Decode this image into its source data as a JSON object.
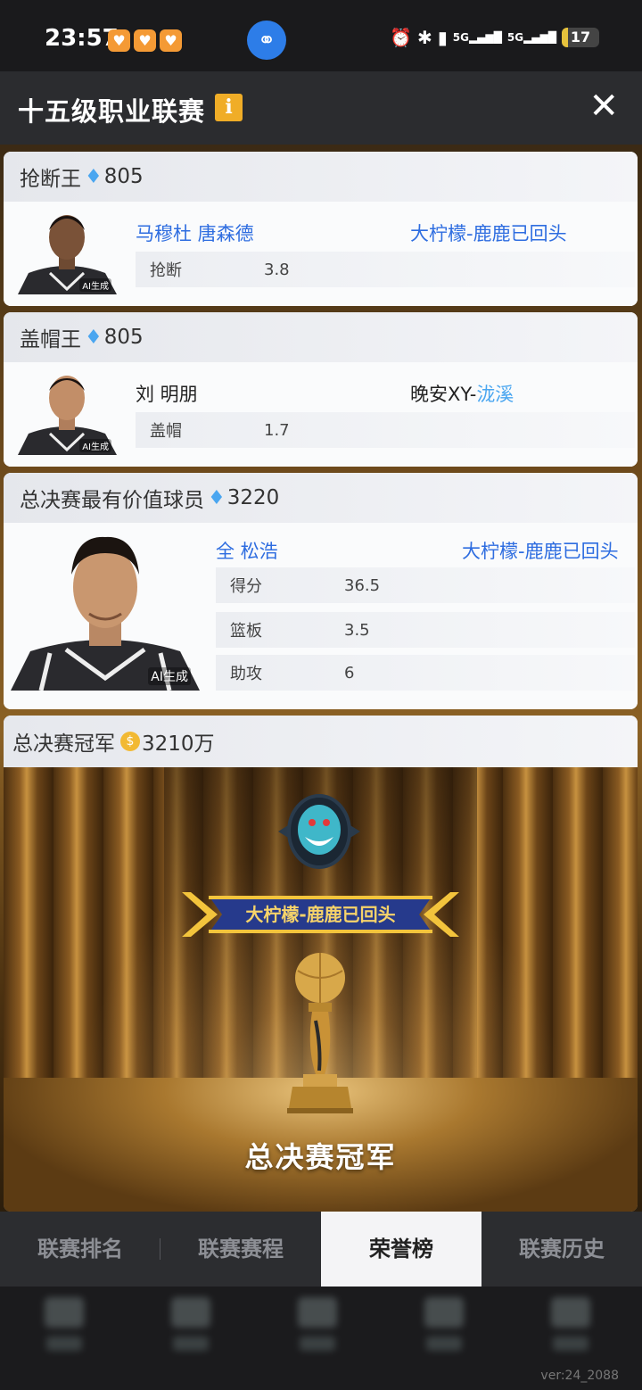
{
  "status_bar": {
    "time": "23:57",
    "network_left": "5G",
    "network_right": "5G",
    "battery": "17"
  },
  "header": {
    "title": "十五级职业联赛",
    "info_icon": "i",
    "close_icon": "✕"
  },
  "awards": {
    "steal": {
      "title": "抢断王",
      "reward": "805",
      "player": "马穆杜 唐森德",
      "team": "大柠檬-鹿鹿已回头",
      "stats": [
        {
          "label": "抢断",
          "value": "3.8"
        }
      ]
    },
    "block": {
      "title": "盖帽王",
      "reward": "805",
      "player": "刘 明朋",
      "team_prefix": "晚安XY-",
      "team_suffix": "泷溪",
      "stats": [
        {
          "label": "盖帽",
          "value": "1.7"
        }
      ]
    },
    "mvp": {
      "title": "总决赛最有价值球员",
      "reward": "3220",
      "player": "全 松浩",
      "team": "大柠檬-鹿鹿已回头",
      "stats": [
        {
          "label": "得分",
          "value": "36.5"
        },
        {
          "label": "篮板",
          "value": "3.5"
        },
        {
          "label": "助攻",
          "value": "6"
        }
      ]
    },
    "champion": {
      "title": "总决赛冠军",
      "reward": "3210万",
      "team": "大柠檬-鹿鹿已回头",
      "caption": "总决赛冠军"
    }
  },
  "ai_tag": "AI生成",
  "tabs": [
    {
      "label": "联赛排名",
      "active": false
    },
    {
      "label": "联赛赛程",
      "active": false
    },
    {
      "label": "荣誉榜",
      "active": true
    },
    {
      "label": "联赛历史",
      "active": false
    }
  ],
  "version": "ver:24_2088",
  "colors": {
    "accent_blue": "#2e6de0",
    "diamond": "#4aa6f0",
    "info_yellow": "#f0ad27"
  }
}
